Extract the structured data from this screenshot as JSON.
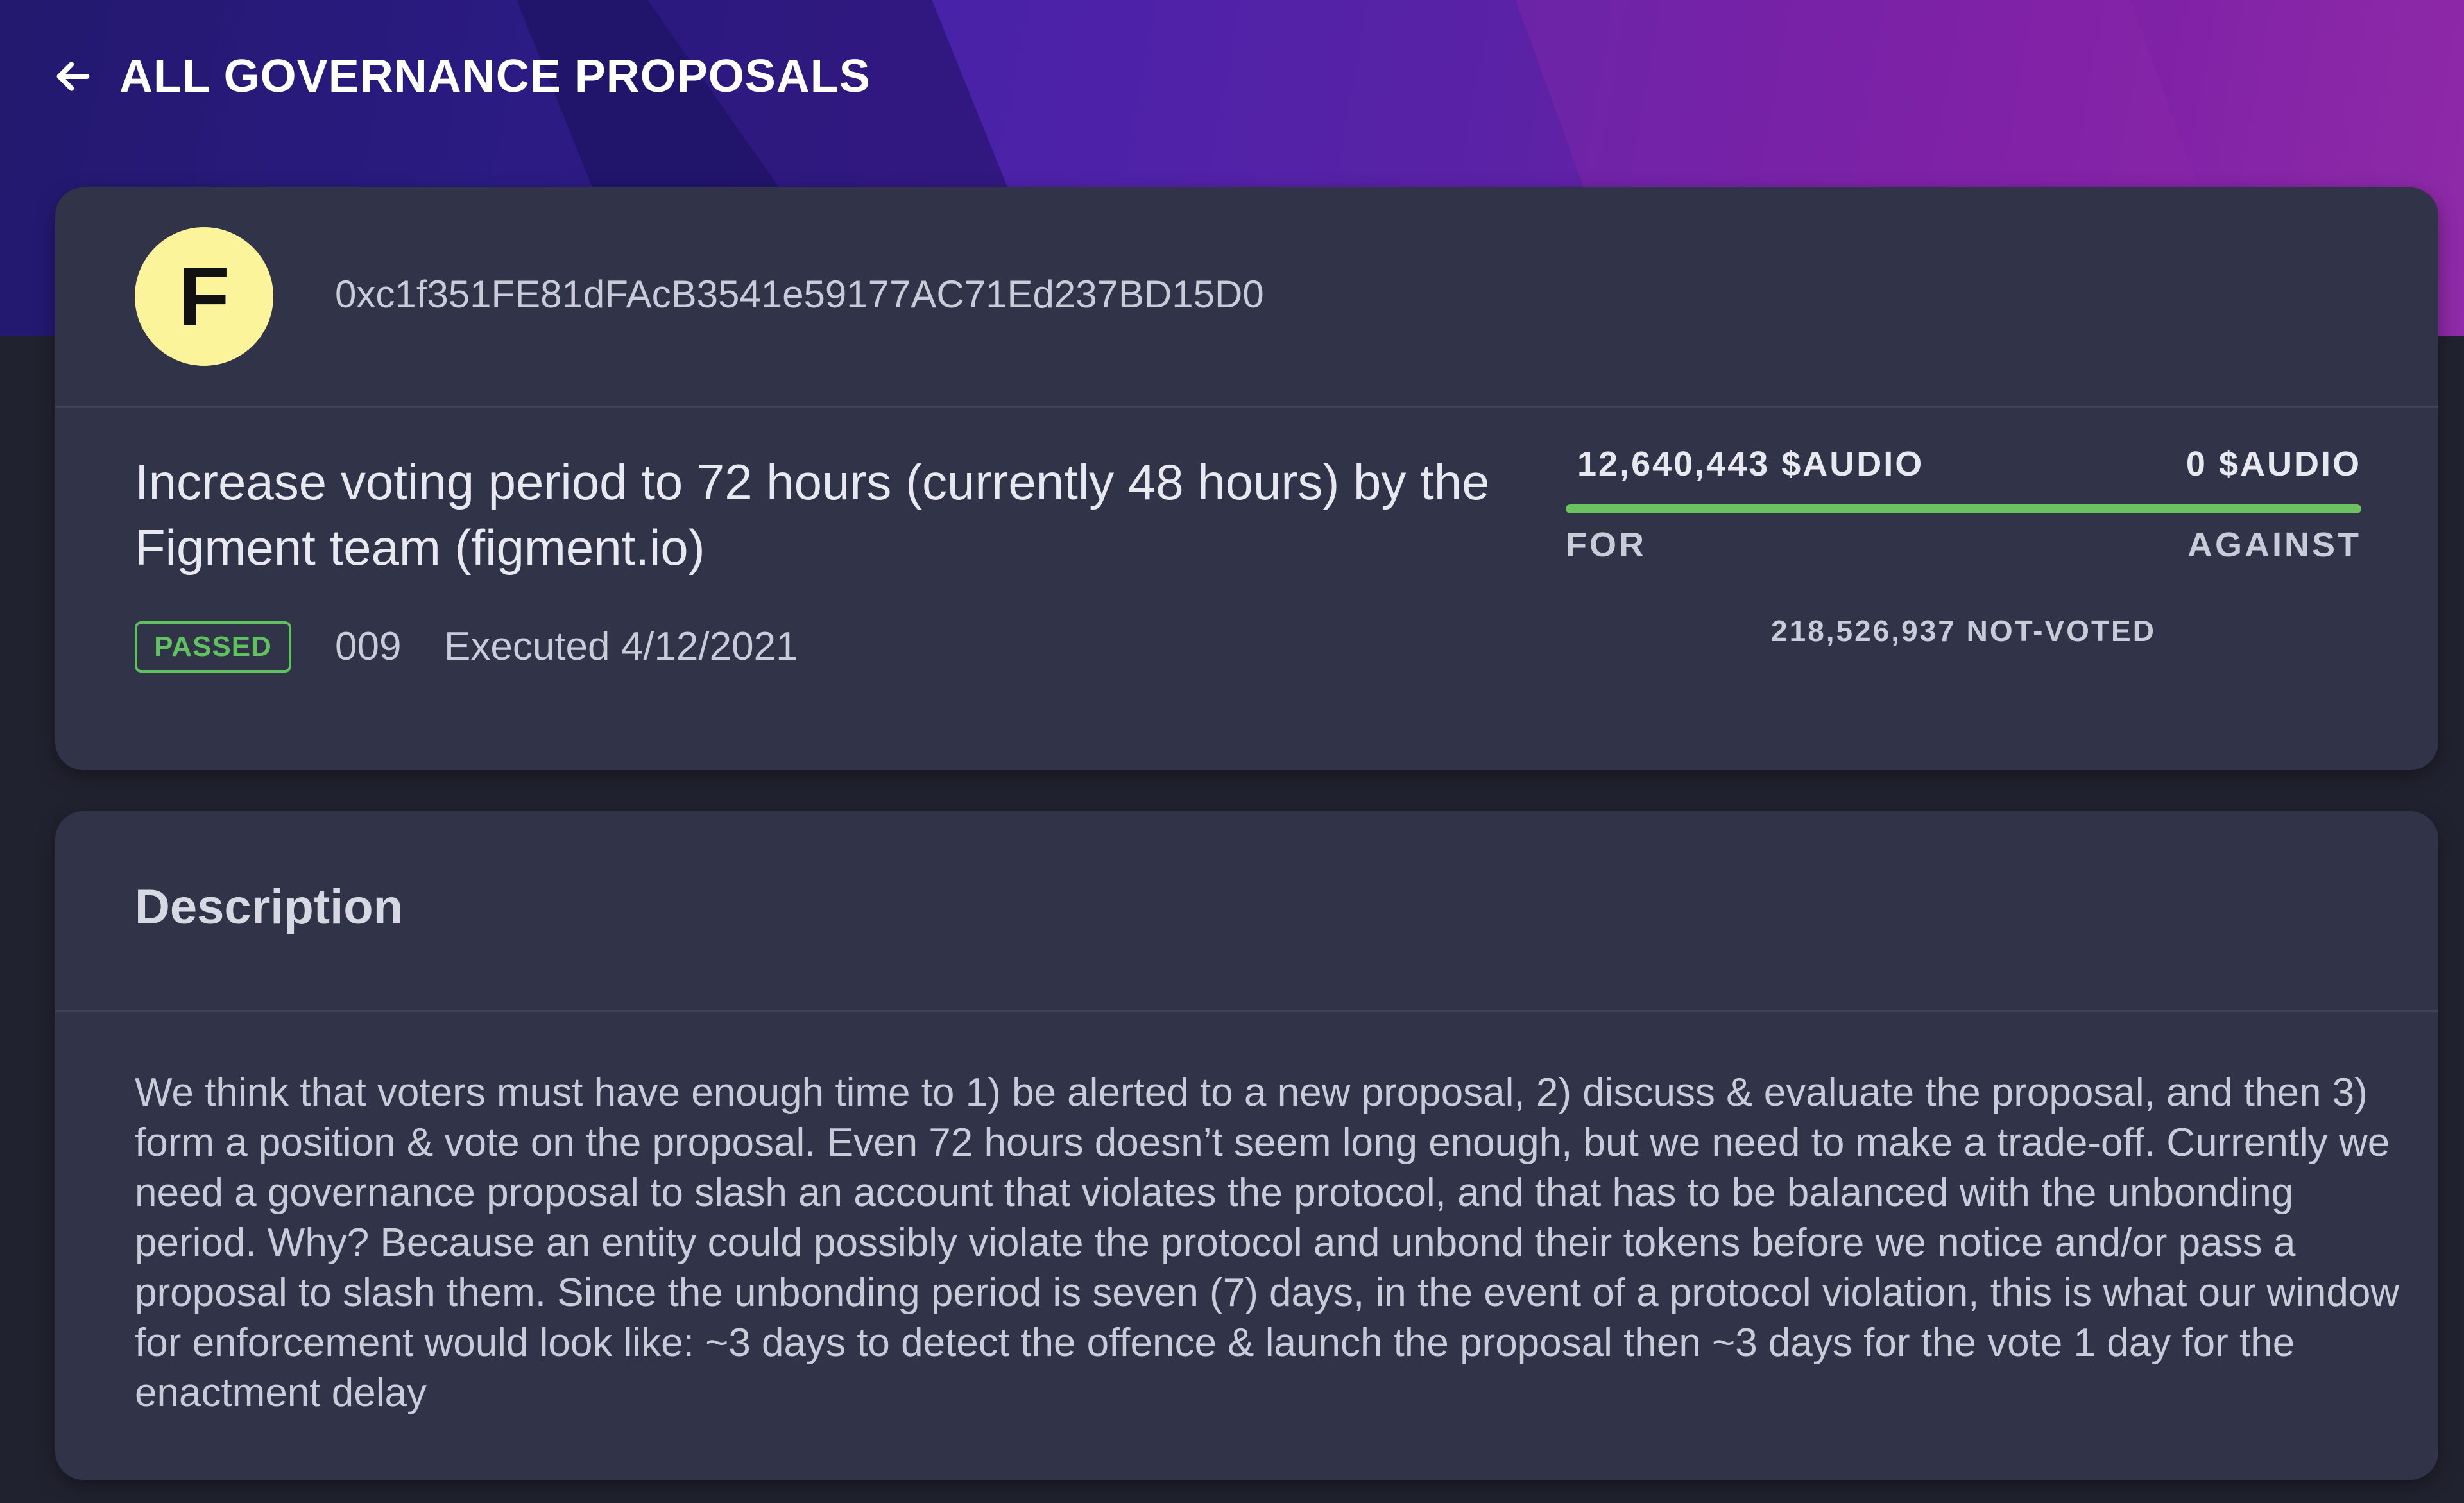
{
  "header": {
    "back_label": "ALL GOVERNANCE PROPOSALS"
  },
  "proposal": {
    "avatar_letter": "F",
    "proposer_address": "0xc1f351FE81dFAcB3541e59177AC71Ed237BD15D0",
    "title": "Increase voting period to 72 hours (currently 48 hours) by the Figment team (figment.io)",
    "status": "PASSED",
    "number": "009",
    "executed": "Executed 4/12/2021",
    "status_color": "#5fc15f"
  },
  "votes": {
    "for_amount": "12,640,443 $AUDIO",
    "against_amount": "0 $AUDIO",
    "for_label": "FOR",
    "against_label": "AGAINST",
    "not_voted": "218,526,937 NOT-VOTED",
    "for_fraction": 1.0,
    "for_color": "#6cc160"
  },
  "description": {
    "heading": "Description",
    "body": "We think that voters must have enough time to 1) be alerted to a new proposal, 2) discuss & evaluate the proposal, and then 3) form a position & vote on the proposal. Even 72 hours doesn’t seem long enough, but we need to make a trade-off. Currently we need a governance proposal to slash an account that violates the protocol, and that has to be balanced with the unbonding period. Why? Because an entity could possibly violate the protocol and unbond their tokens before we notice and/or pass a proposal to slash them. Since the unbonding period is seven (7) days, in the event of a protocol violation, this is what our window for enforcement would look like: ~3 days to detect the offence & launch the proposal then ~3 days for the vote 1 day for the enactment delay"
  }
}
